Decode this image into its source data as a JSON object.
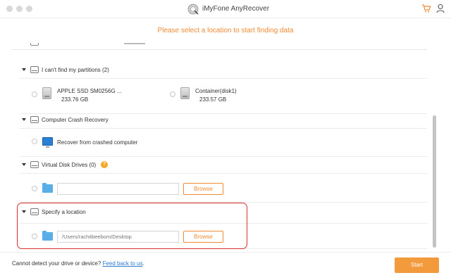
{
  "window": {
    "title": "iMyFone AnyRecover",
    "controls": [
      "close",
      "minimize",
      "zoom"
    ],
    "header_icons": [
      "cart-icon",
      "user-icon"
    ]
  },
  "subtitle": "Please select a location to start finding data",
  "sections": {
    "partitions": {
      "label": "I can't find my partitions (2)",
      "items": [
        {
          "name": "APPLE SSD SM0256G ...",
          "size": "233.76 GB",
          "icon": "disk-icon"
        },
        {
          "name": "Container(disk1)",
          "size": "233.57 GB",
          "icon": "disk-icon"
        }
      ]
    },
    "crash": {
      "label": "Computer Crash Recovery",
      "item": {
        "name": "Recover from crashed computer",
        "icon": "monitor-icon"
      }
    },
    "virtual": {
      "label": "Virtual Disk Drives (0)",
      "help_icon": "?",
      "path_value": "",
      "browse_label": "Browse"
    },
    "specify": {
      "label": "Specify a location",
      "path_placeholder": "/Users/rachitbeebom/Desktop",
      "browse_label": "Browse"
    }
  },
  "footer": {
    "text": "Cannot detect your drive or device?",
    "link": "Feed back to us",
    "link_suffix": ".",
    "start_label": "Start"
  },
  "colors": {
    "accent": "#f08a34",
    "start_button": "#f39a3d",
    "link": "#2e7ad1",
    "highlight": "#d9302e"
  }
}
